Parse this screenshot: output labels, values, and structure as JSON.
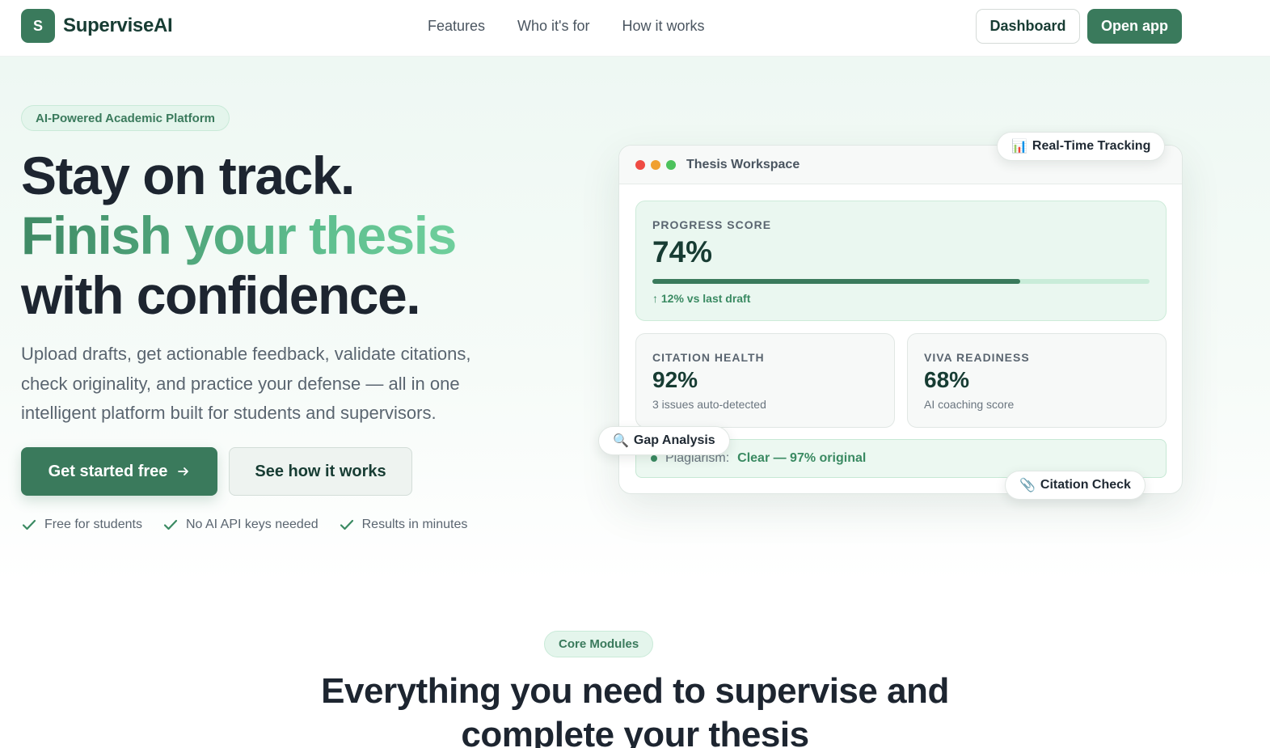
{
  "nav": {
    "logo_letter": "S",
    "brand": "SuperviseAI",
    "links": [
      "Features",
      "Who it's for",
      "How it works"
    ],
    "dashboard_label": "Dashboard",
    "open_app_label": "Open app"
  },
  "hero": {
    "pill": "AI-Powered Academic Platform",
    "headline_1": "Stay on track.",
    "headline_2": "Finish your thesis",
    "headline_3": "with confidence.",
    "subtext": "Upload drafts, get actionable feedback, validate citations, check originality, and practice your defense — all in one intelligent platform built for students and supervisors.",
    "primary_cta": "Get started free",
    "primary_cta_icon": "arrow-right-icon",
    "secondary_cta": "See how it works",
    "checks": [
      "Free for students",
      "No AI API keys needed",
      "Results in minutes"
    ]
  },
  "workspace": {
    "title": "Thesis Workspace",
    "window_dots": [
      "#ef4b43",
      "#f0a030",
      "#4cc25c"
    ],
    "progress": {
      "label": "PROGRESS SCORE",
      "value": "74%",
      "fraction": 0.74,
      "trend": "↑ 12% vs last draft"
    },
    "citation": {
      "label": "CITATION HEALTH",
      "value": "92%",
      "sub": "3 issues auto-detected"
    },
    "viva": {
      "label": "VIVA READINESS",
      "value": "68%",
      "sub": "AI coaching score"
    },
    "plagiarism": {
      "label": "Plagiarism:",
      "value": "Clear — 97% original"
    }
  },
  "tags": {
    "realtime": {
      "icon": "bar-chart-icon",
      "glyph": "📊",
      "label": "Real-Time Tracking"
    },
    "gap": {
      "icon": "magnifier-icon",
      "glyph": "🔍",
      "label": "Gap Analysis"
    },
    "citation": {
      "icon": "paperclip-icon",
      "glyph": "📎",
      "label": "Citation Check"
    }
  },
  "core": {
    "pill": "Core Modules",
    "title_1": "Everything you need to supervise and",
    "title_2": "complete your thesis"
  },
  "colors": {
    "brand": "#3a7a5c",
    "accent_light": "#e4f5ec",
    "text_dark": "#1d2530"
  }
}
